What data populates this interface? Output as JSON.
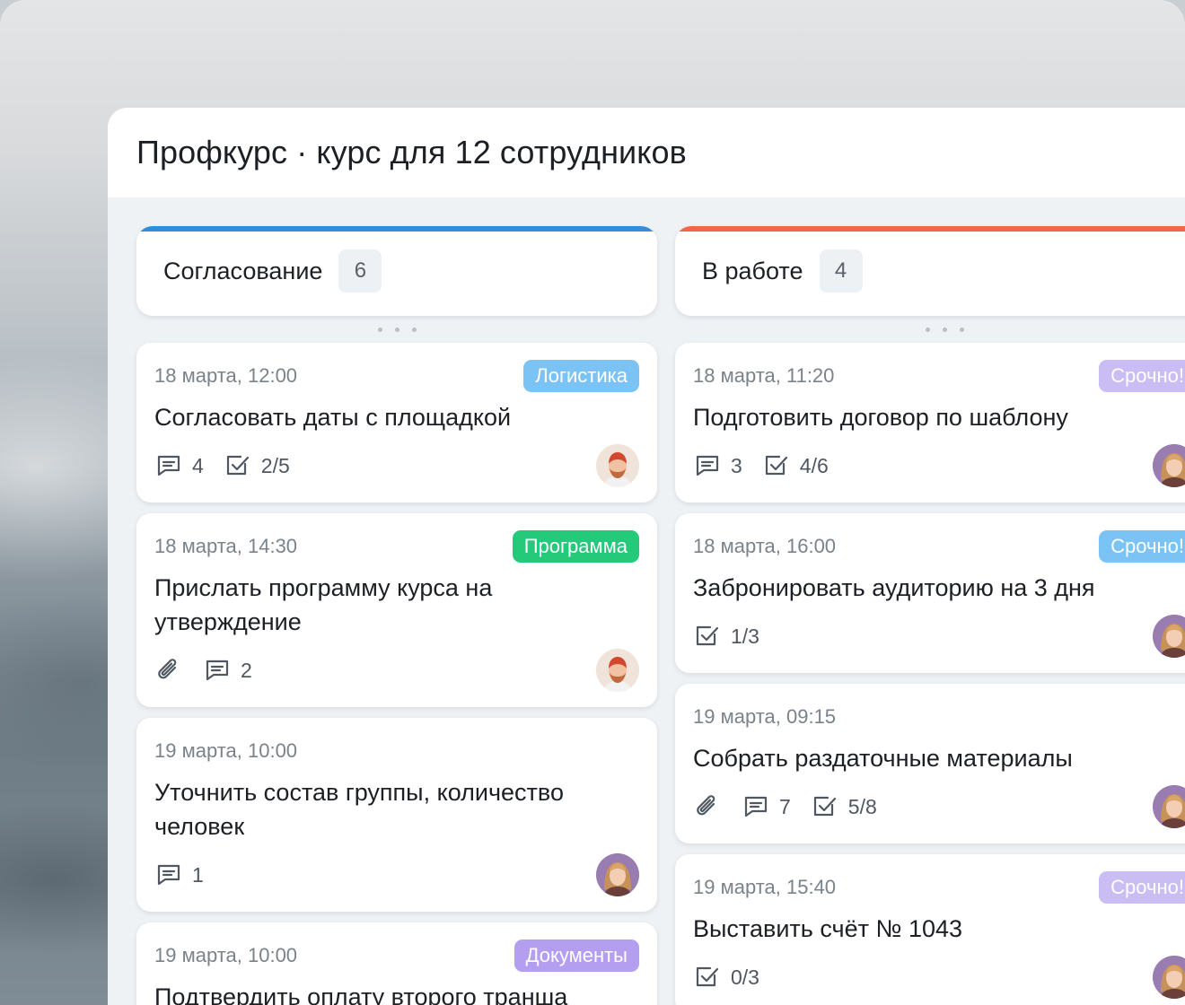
{
  "window": {
    "title": "Профкурс · курс для 12 сотрудников"
  },
  "columns": [
    {
      "name": "Согласование",
      "count": "6",
      "accent": "#2f8fdc",
      "cards": [
        {
          "date": "18 марта, 12:00",
          "tag": "Логистика",
          "tag_color": "#7cc3f5",
          "title": "Согласовать даты с площадкой",
          "comments": "4",
          "checklist": "2/5",
          "avatar": "man"
        },
        {
          "date": "18 марта, 14:30",
          "tag": "Программа",
          "tag_color": "#24c97a",
          "title": "Прислать программу курса на утверждение",
          "comments": "2",
          "attachment": true,
          "avatar": "man"
        },
        {
          "date": "19 марта, 10:00",
          "title": " Уточнить состав группы, количество человек",
          "comments": "1",
          "avatar": "woman"
        },
        {
          "date": "19 марта, 10:00",
          "tag": "Документы",
          "tag_color": "#b39ef0",
          "title": " Подтвердить оплату второго транша"
        }
      ]
    },
    {
      "name": "В работе",
      "count": "4",
      "accent": "#f2674b",
      "cards": [
        {
          "date": "18 марта, 11:20",
          "tag": "Срочно!",
          "tag_color": "#c9bdf3",
          "title": "Подготовить договор по шаблону",
          "comments": "3",
          "checklist": "4/6",
          "avatar": "woman"
        },
        {
          "date": "18 марта, 16:00",
          "tag": "Срочно!",
          "tag_color": "#7cc3f5",
          "title": "Забронировать аудиторию на 3 дня",
          "checklist": "1/3",
          "avatar": "woman"
        },
        {
          "date": "19 марта, 09:15",
          "title": "Собрать раздаточные материалы",
          "comments": "7",
          "checklist": "5/8",
          "attachment": true,
          "avatar": "woman"
        },
        {
          "date": "19 марта, 15:40",
          "tag": "Срочно!",
          "tag_color": "#c9bdf3",
          "title": "Выставить счёт № 1043",
          "checklist": "0/3",
          "avatar": "woman"
        }
      ]
    }
  ],
  "icons": {
    "comment": "comment-icon",
    "checklist": "checkbox-icon",
    "attachment": "paperclip-icon"
  }
}
